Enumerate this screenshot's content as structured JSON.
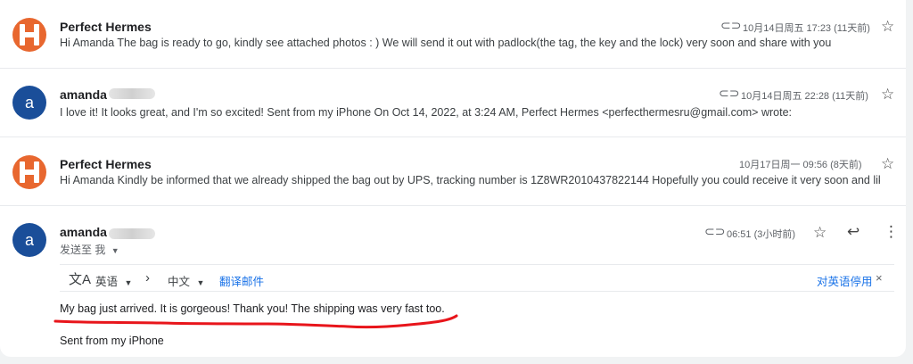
{
  "messages": [
    {
      "sender": "Perfect Hermes",
      "snippet": "Hi Amanda The bag is ready to go, kindly see attached photos : ) We will send it out with padlock(the tag, the key and the lock) very soon and share with you tr",
      "date": "10月14日周五 17:23 (11天前)",
      "attachment": true,
      "avatar": "H"
    },
    {
      "sender": "amanda",
      "snippet": "I love it! It looks great, and I'm so excited! Sent from my iPhone On Oct 14, 2022, at 3:24 AM, Perfect Hermes <perfecthermesru@gmail.com> wrote:",
      "date": "10月14日周五 22:28 (11天前)",
      "attachment": true,
      "avatar": "a"
    },
    {
      "sender": "Perfect Hermes",
      "snippet": "Hi Amanda Kindly be informed that we already shipped the bag out by UPS, tracking number is 1Z8WR2010437822144 Hopefully you could receive it very soon and like",
      "date": "10月17日周一 09:56 (8天前)",
      "attachment": false,
      "avatar": "H"
    }
  ],
  "open_message": {
    "sender": "amanda",
    "avatar": "a",
    "to_line": "发送至 我",
    "date": "06:51 (3小时前)",
    "translate": {
      "from_lang": "英语",
      "to_lang": "中文",
      "translate_link": "翻译邮件",
      "disable_link": "对英语停用"
    },
    "body_line1": "My bag just arrived. It is gorgeous! Thank you! The shipping was very fast too.",
    "signature": "Sent from my iPhone"
  },
  "colors": {
    "hermes_avatar": "#e8672f",
    "amanda_avatar": "#1a4e99",
    "underline": "#e8151b",
    "link": "#1a73e8"
  }
}
